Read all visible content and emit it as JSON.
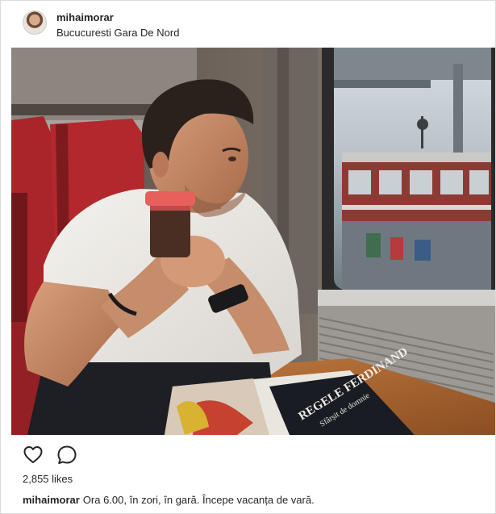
{
  "post": {
    "username": "mihaimorar",
    "location": "Bucucuresti Gara De Nord",
    "likes": "2,855 likes",
    "caption_user": "mihaimorar",
    "caption_text": "Ora 6.00, în zori, în gară. Începe vacanța de vară."
  },
  "icons": {
    "like": "heart-outline-icon",
    "comment": "comment-bubble-icon"
  },
  "photo": {
    "magazine_title": "REGELE FERDINAND",
    "magazine_subtitle": "Sfârșit de domnie"
  },
  "colors": {
    "text": "#262626",
    "border": "#dbdbdb",
    "seat_red": "#b3282d",
    "cup_lid": "#e8605c"
  }
}
